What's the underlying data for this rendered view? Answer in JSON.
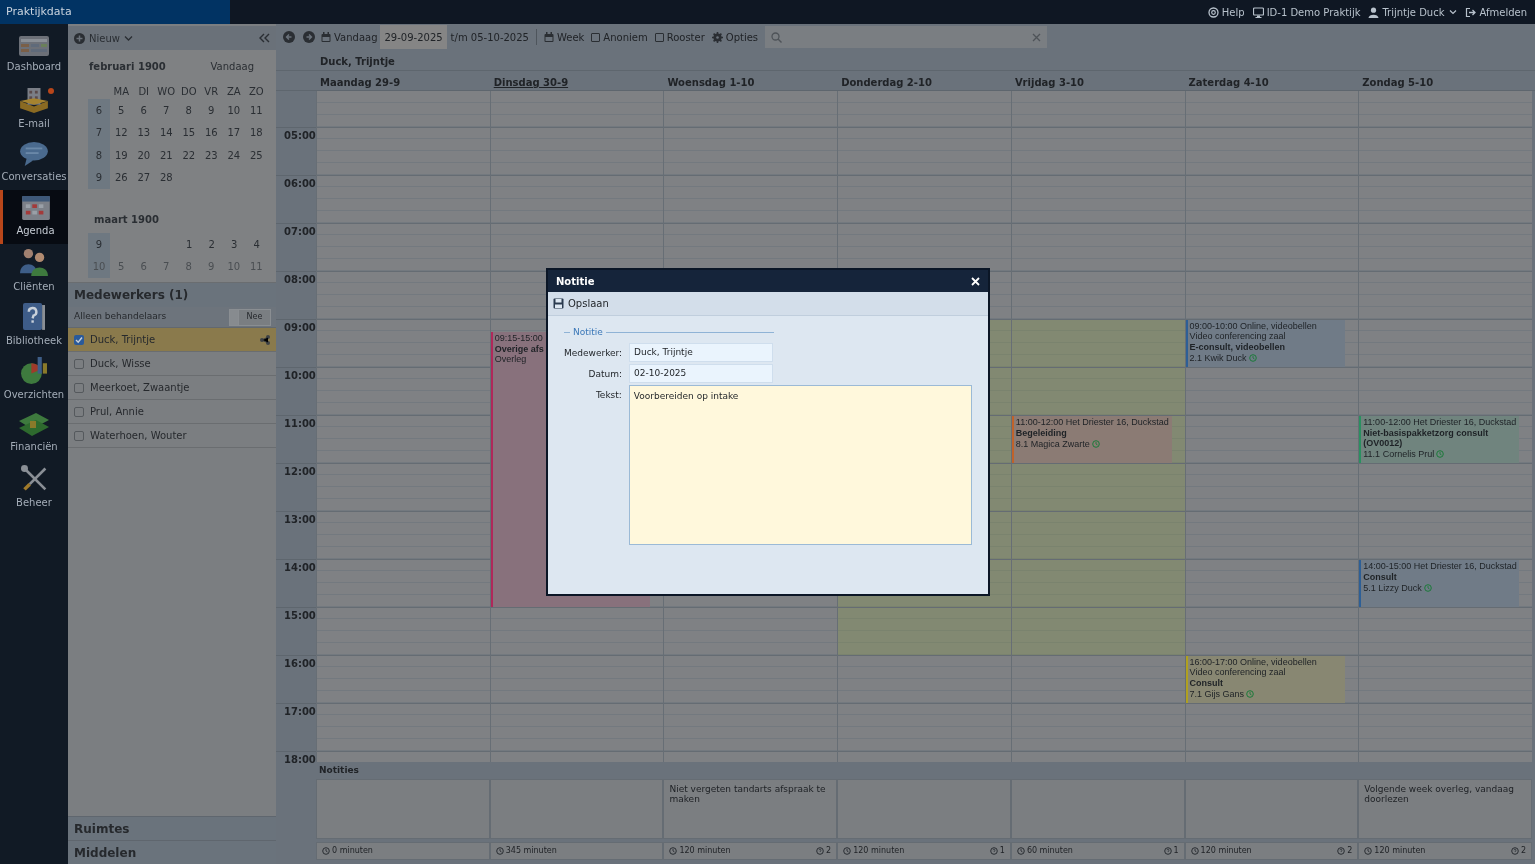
{
  "top_bar": {
    "brand": "Praktijkdata",
    "links": [
      {
        "kind": "help",
        "label": "Help"
      },
      {
        "kind": "practice",
        "label": "ID-1 Demo Praktijk"
      },
      {
        "kind": "user",
        "label": "Trijntje Duck"
      },
      {
        "kind": "logout",
        "label": "Afmelden"
      }
    ]
  },
  "nav": [
    {
      "kind": "dashboard",
      "label": "Dashboard",
      "selected": false,
      "badge": false
    },
    {
      "kind": "email",
      "label": "E-mail",
      "selected": false,
      "badge": true
    },
    {
      "kind": "chat",
      "label": "Conversaties",
      "selected": false,
      "badge": false
    },
    {
      "kind": "calendar",
      "label": "Agenda",
      "selected": true,
      "badge": false
    },
    {
      "kind": "people",
      "label": "Cliënten",
      "selected": false,
      "badge": false
    },
    {
      "kind": "book",
      "label": "Bibliotheek",
      "selected": false,
      "badge": false
    },
    {
      "kind": "chart",
      "label": "Overzichten",
      "selected": false,
      "badge": false
    },
    {
      "kind": "money",
      "label": "Financiën",
      "selected": false,
      "badge": false
    },
    {
      "kind": "tools",
      "label": "Beheer",
      "selected": false,
      "badge": false
    }
  ],
  "side_panel": {
    "new_button": "Nieuw",
    "months": [
      {
        "title": "februari 1900",
        "today_link": "Vandaag",
        "weekdays": [
          "MA",
          "DI",
          "WO",
          "DO",
          "VR",
          "ZA",
          "ZO"
        ],
        "weeks": [
          {
            "number": "6",
            "dim": false,
            "days": [
              "5",
              "6",
              "7",
              "8",
              "9",
              "10",
              "11"
            ]
          },
          {
            "number": "7",
            "dim": false,
            "days": [
              "12",
              "13",
              "14",
              "15",
              "16",
              "17",
              "18"
            ]
          },
          {
            "number": "8",
            "dim": false,
            "days": [
              "19",
              "20",
              "21",
              "22",
              "23",
              "24",
              "25"
            ]
          },
          {
            "number": "9",
            "dim": false,
            "days": [
              "26",
              "27",
              "28"
            ]
          }
        ]
      },
      {
        "title": "maart 1900",
        "weeks": [
          {
            "number": "9",
            "dim": false,
            "days": [
              "1",
              "2",
              "3",
              "4"
            ]
          },
          {
            "number": "10",
            "dim": true,
            "days": [
              "5",
              "6",
              "7",
              "8",
              "9",
              "10",
              "11"
            ]
          }
        ]
      }
    ],
    "staff": {
      "title": "Medewerkers (1)",
      "filter_label": "Alleen behandelaars",
      "filter_toggle": {
        "label": "Nee",
        "on": false
      },
      "members": [
        {
          "name": "Duck, Trijntje",
          "checked": true,
          "selected": true
        },
        {
          "name": "Duck, Wisse",
          "checked": false,
          "selected": false
        },
        {
          "name": "Meerkoet, Zwaantje",
          "checked": false,
          "selected": false
        },
        {
          "name": "Prul, Annie",
          "checked": false,
          "selected": false
        },
        {
          "name": "Waterhoen, Wouter",
          "checked": false,
          "selected": false
        }
      ]
    },
    "sections": [
      "Ruimtes",
      "Middelen"
    ]
  },
  "toolbar": {
    "today": "Vandaag",
    "date_from": "29-09-2025",
    "date_to": "t/m 05-10-2025",
    "view": "Week",
    "checkboxes": [
      {
        "label": "Anoniem",
        "checked": false
      },
      {
        "label": "Rooster",
        "checked": false
      }
    ],
    "options": "Opties"
  },
  "calendar": {
    "employee": "Duck, Trijntje",
    "hours": [
      "05:00",
      "06:00",
      "07:00",
      "08:00",
      "09:00",
      "10:00",
      "11:00",
      "12:00",
      "13:00",
      "14:00",
      "15:00",
      "16:00",
      "17:00",
      "18:00"
    ],
    "notes_title": "Notities",
    "days": [
      {
        "label": "Maandag 29-9",
        "today": false,
        "available": false,
        "total": "0 minuten"
      },
      {
        "label": "Dinsdag 30-9",
        "today": true,
        "available": false,
        "total": "345 minuten",
        "events": [
          {
            "time": "09:15-15:00",
            "title": "Overige afs",
            "subtitle": "Overleg",
            "color": "#b0285a"
          }
        ]
      },
      {
        "label": "Woensdag 1-10",
        "today": false,
        "available": false,
        "note": "Niet vergeten tandarts afspraak te maken",
        "total": "120 minuten",
        "questions": "2"
      },
      {
        "label": "Donderdag 2-10",
        "today": false,
        "available": true,
        "total": "120 minuten",
        "questions": "1"
      },
      {
        "label": "Vrijdag 3-10",
        "today": false,
        "available": true,
        "total": "60 minuten",
        "questions": "1",
        "events": [
          {
            "time": "11:00-12:00",
            "location": "Het Driester 16, Duckstad",
            "title": "Begeleiding",
            "client": "8.1 Magica Zwarte",
            "color": "#c0622a"
          }
        ]
      },
      {
        "label": "Zaterdag 4-10",
        "today": false,
        "available": false,
        "total": "120 minuten",
        "questions": "2",
        "events": [
          {
            "time": "09:00-10:00",
            "location": "Online, videobellen",
            "room": "Video conferencing zaal",
            "title": "E-consult, videobellen",
            "client": "2.1 Kwik Duck",
            "color": "#2d5f96"
          },
          {
            "time": "16:00-17:00",
            "location": "Online, videobellen",
            "room": "Video conferencing zaal",
            "title": "Consult",
            "client": "7.1 Gijs Gans",
            "color": "#b0a020"
          }
        ]
      },
      {
        "label": "Zondag 5-10",
        "today": false,
        "available": false,
        "note": "Volgende week overleg, vandaag doorlezen",
        "total": "120 minuten",
        "questions": "2",
        "events": [
          {
            "time": "11:00-12:00",
            "location": "Het Driester 16, Duckstad",
            "title": "Niet-basispakketzorg consult (OV0012)",
            "client": "11.1 Cornelis Prul",
            "color": "#2a9060"
          },
          {
            "time": "14:00-15:00",
            "location": "Het Driester 16, Duckstad",
            "title": "Consult",
            "client": "5.1 Lizzy Duck",
            "color": "#2d5f96"
          }
        ]
      }
    ]
  },
  "dialog": {
    "title": "Notitie",
    "save": "Opslaan",
    "legend": "Notitie",
    "fields": [
      {
        "kind": "text",
        "label": "Medewerker:",
        "value": "Duck, Trijntje"
      },
      {
        "kind": "text",
        "label": "Datum:",
        "value": "02-10-2025"
      },
      {
        "kind": "textarea",
        "label": "Tekst:",
        "value": "Voorbereiden op intake"
      }
    ]
  }
}
